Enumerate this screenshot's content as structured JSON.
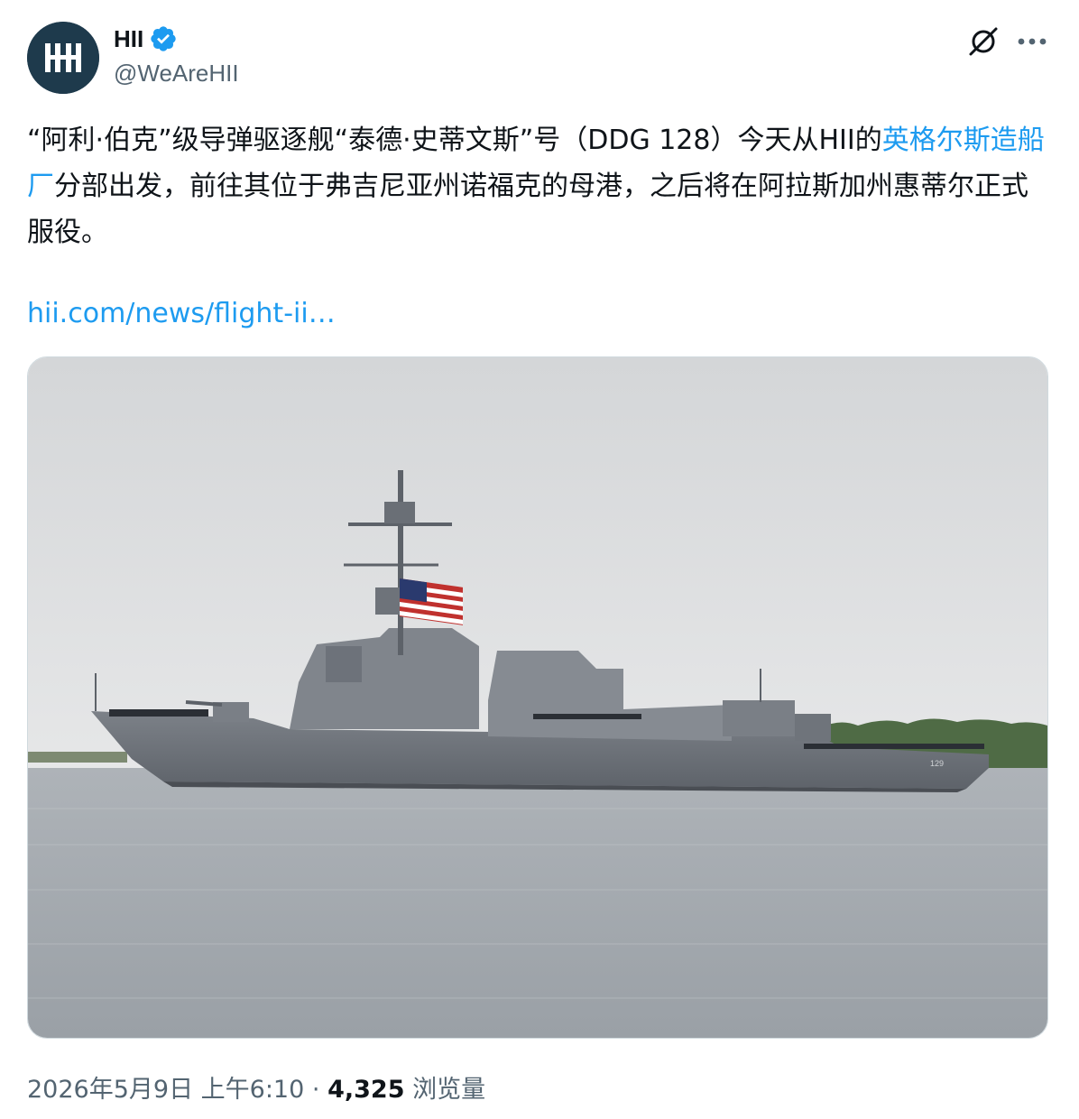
{
  "author": {
    "display_name": "HII",
    "handle": "@WeAreHII",
    "avatar_label": "HII",
    "verified_color": "#1d9bf0"
  },
  "post": {
    "text_part1": "“阿利·伯克”级导弹驱逐舰“泰德·史蒂文斯”号（DDG 128）今天从HII的",
    "text_link": "英格尔斯造船厂",
    "text_part2": "分部出发，前往其位于弗吉尼亚州诺福克的母港，之后将在阿拉斯加州惠蒂尔正式服役。",
    "url_text": "hii.com/news/flight-ii…",
    "media_description_hidden": "",
    "hull_number": "129"
  },
  "footer": {
    "timestamp": "2026年5月9日 上午6:10",
    "separator": "·",
    "views_count": "4,325",
    "views_label": "浏览量"
  },
  "icons": {
    "grok": "grok-icon",
    "more": "more-icon",
    "verified": "verified-badge-icon"
  },
  "colors": {
    "link": "#1d9bf0",
    "secondary": "#536471",
    "primary": "#0f1419"
  }
}
